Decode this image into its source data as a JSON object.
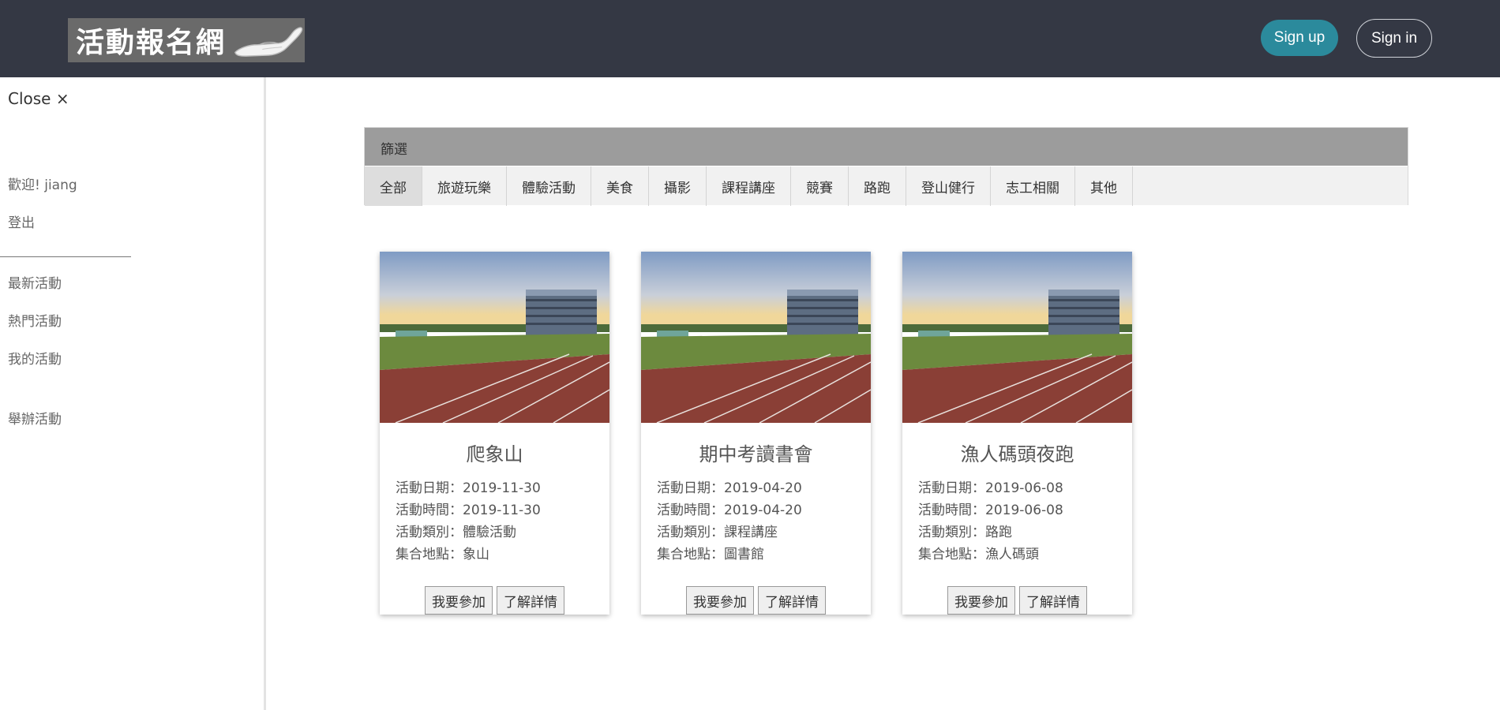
{
  "header": {
    "logo_text": "活動報名網",
    "signup_label": "Sign up",
    "signin_label": "Sign in"
  },
  "sidebar": {
    "close_label": "Close ×",
    "welcome": "歡迎! jiang",
    "logout": "登出",
    "items": [
      {
        "label": "最新活動"
      },
      {
        "label": "熱門活動"
      },
      {
        "label": "我的活動"
      },
      {
        "label": "舉辦活動"
      }
    ]
  },
  "filter": {
    "title": "篩選",
    "tabs": [
      {
        "label": "全部",
        "active": true
      },
      {
        "label": "旅遊玩樂"
      },
      {
        "label": "體驗活動"
      },
      {
        "label": "美食"
      },
      {
        "label": "攝影"
      },
      {
        "label": "課程講座"
      },
      {
        "label": "競賽"
      },
      {
        "label": "路跑"
      },
      {
        "label": "登山健行"
      },
      {
        "label": "志工相關"
      },
      {
        "label": "其他"
      }
    ]
  },
  "events": [
    {
      "title": "爬象山",
      "date_label": "活動日期：2019-11-30",
      "time_label": "活動時間：2019-11-30",
      "category_label": "活動類別：體驗活動",
      "location_label": "集合地點：象山",
      "join_label": "我要參加",
      "detail_label": "了解詳情"
    },
    {
      "title": "期中考讀書會",
      "date_label": "活動日期：2019-04-20",
      "time_label": "活動時間：2019-04-20",
      "category_label": "活動類別：課程講座",
      "location_label": "集合地點：圖書館",
      "join_label": "我要參加",
      "detail_label": "了解詳情"
    },
    {
      "title": "漁人碼頭夜跑",
      "date_label": "活動日期：2019-06-08",
      "time_label": "活動時間：2019-06-08",
      "category_label": "活動類別：路跑",
      "location_label": "集合地點：漁人碼頭",
      "join_label": "我要參加",
      "detail_label": "了解詳情"
    }
  ],
  "colors": {
    "topbar": "#343844",
    "signup": "#2b8a9c",
    "filter_head": "#9c9c9c"
  }
}
